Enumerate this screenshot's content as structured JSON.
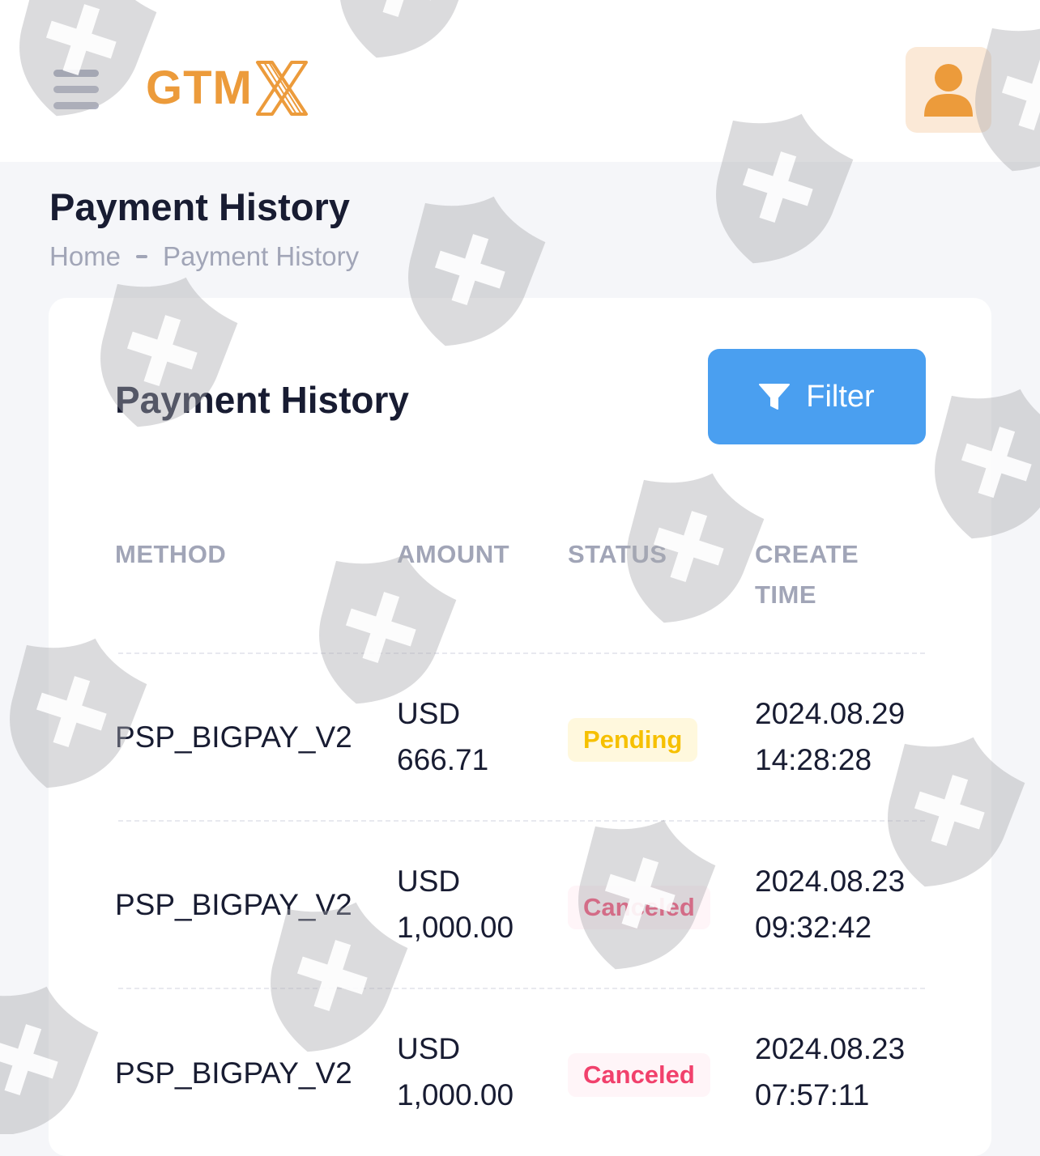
{
  "header": {
    "logo_text": "GTM",
    "logo_mark": "X",
    "menu_icon": "hamburger-menu-icon",
    "user_icon": "user-icon",
    "brand_color": "#ec9b3b",
    "avatar_bg": "#fbe9d7"
  },
  "page": {
    "title": "Payment History",
    "breadcrumb": [
      "Home",
      "Payment History"
    ]
  },
  "card": {
    "title": "Payment History",
    "filter_label": "Filter",
    "filter_icon": "funnel-icon",
    "accent_color": "#4a9ff0"
  },
  "table": {
    "columns": [
      "METHOD",
      "AMOUNT",
      "STATUS",
      "CREATE",
      "TIME"
    ],
    "rows": [
      {
        "method": "PSP_BIGPAY_V2",
        "currency": "USD",
        "amount": "666.71",
        "status": "Pending",
        "date": "2024.08.29",
        "time": "14:28:28"
      },
      {
        "method": "PSP_BIGPAY_V2",
        "currency": "USD",
        "amount": "1,000.00",
        "status": "Canceled",
        "date": "2024.08.23",
        "time": "09:32:42"
      },
      {
        "method": "PSP_BIGPAY_V2",
        "currency": "USD",
        "amount": "1,000.00",
        "status": "Canceled",
        "date": "2024.08.23",
        "time": "07:57:11"
      }
    ]
  },
  "status_colors": {
    "pending_text": "#f6c000",
    "pending_bg": "#fff8dd",
    "canceled_text": "#f1416c",
    "canceled_bg": "#fff5f8"
  },
  "watermark": {
    "icon": "shield-plus-icon"
  }
}
